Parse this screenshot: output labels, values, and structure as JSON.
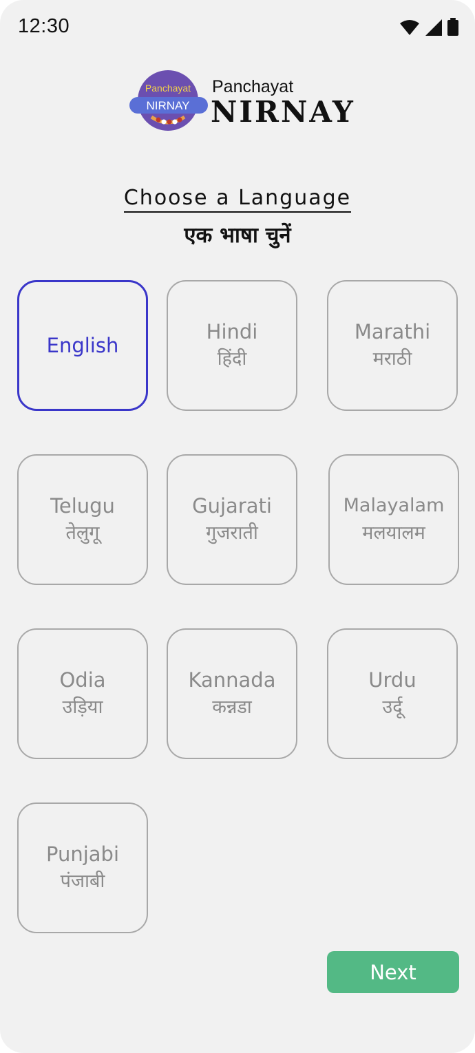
{
  "status_bar": {
    "time": "12:30",
    "icons": [
      "wifi-icon",
      "cellular-signal-icon",
      "battery-icon"
    ]
  },
  "logo": {
    "badge_line1": "Panchayat",
    "badge_line2": "NIRNAY",
    "title_small": "Panchayat",
    "title_big": "NIRNAY"
  },
  "heading": {
    "english": "Choose a Language",
    "hindi": "एक भाषा चुनें"
  },
  "languages": [
    {
      "name": "English",
      "native": "",
      "selected": true
    },
    {
      "name": "Hindi",
      "native": "हिंदी",
      "selected": false
    },
    {
      "name": "Marathi",
      "native": "मराठी",
      "selected": false
    },
    {
      "name": "Telugu",
      "native": "तेलुगू",
      "selected": false
    },
    {
      "name": "Gujarati",
      "native": "गुजराती",
      "selected": false
    },
    {
      "name": "Malayalam",
      "native": "मलयालम",
      "selected": false
    },
    {
      "name": "Odia",
      "native": "उड़िया",
      "selected": false
    },
    {
      "name": "Kannada",
      "native": "कन्नडा",
      "selected": false
    },
    {
      "name": "Urdu",
      "native": "उर्दू",
      "selected": false
    },
    {
      "name": "Punjabi",
      "native": "पंजाबी",
      "selected": false
    }
  ],
  "next_button": {
    "label": "Next"
  },
  "colors": {
    "background": "#f1f1f1",
    "selected_border": "#3a36c9",
    "unselected_border": "#a8a8a8",
    "unselected_text": "#8a8a8a",
    "next_button": "#53b985",
    "logo_badge": "#6b4fb0",
    "logo_badge_ribbon": "#5a6fd6"
  }
}
